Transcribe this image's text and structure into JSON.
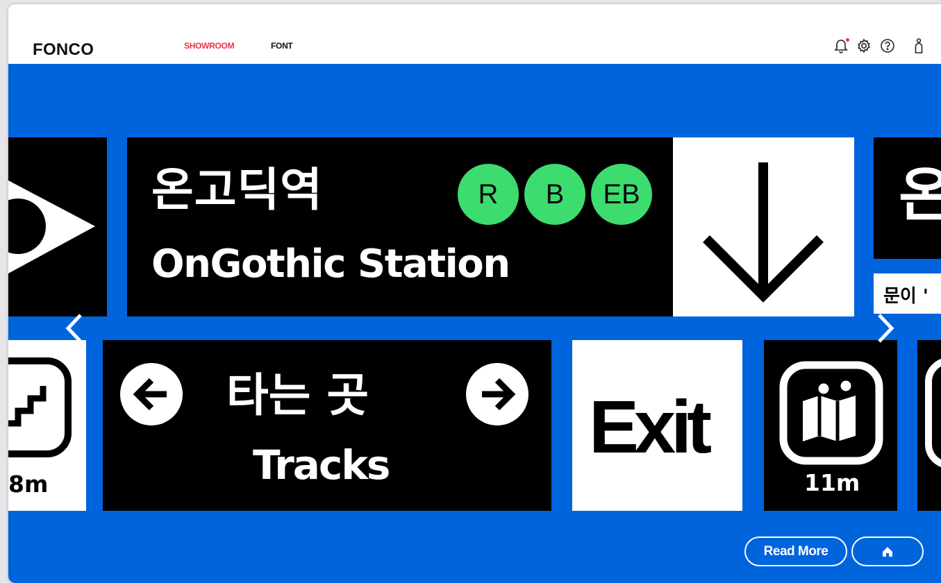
{
  "window": {
    "traffic_lights": [
      "#ff5f57",
      "#febc2e",
      "#28c840"
    ]
  },
  "header": {
    "logo": "FONCO",
    "nav": [
      {
        "label": "SHOWROOM",
        "active": true,
        "color": "#e8334a"
      },
      {
        "label": "FONT",
        "active": false,
        "color": "#111111"
      }
    ],
    "icons": [
      "bell-icon",
      "gear-icon",
      "help-icon",
      "user-icon"
    ],
    "notification_dot_color": "#e8334a"
  },
  "showcase": {
    "background": "#0064dc",
    "badge_color": "#3ddc6f",
    "station": {
      "name_ko": "온고딕역",
      "name_en": "OnGothic Station",
      "lines": [
        "R",
        "B",
        "EB"
      ]
    },
    "next_panel": {
      "ko_partial": "온",
      "sub_partial": "문이 '"
    },
    "tracks": {
      "ko": "타는 곳",
      "en": "Tracks"
    },
    "exit": {
      "label": "Exit"
    },
    "stairs": {
      "distance": "8m"
    },
    "map": {
      "distance": "11m"
    }
  },
  "footer": {
    "read_more_label": "Read More",
    "home_icon": "home-icon"
  }
}
